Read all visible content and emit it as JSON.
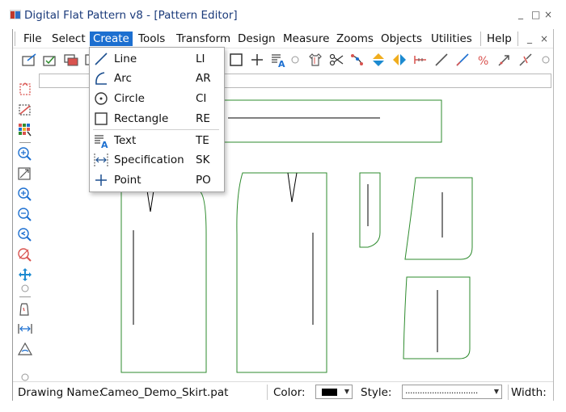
{
  "window": {
    "title": "Digital Flat Pattern v8 - [Pattern Editor]",
    "app_controls": [
      "_",
      "□",
      "×"
    ],
    "doc_controls": [
      "_",
      "□",
      "×"
    ]
  },
  "menubar": {
    "items": [
      "File",
      "Select",
      "Create",
      "Tools",
      "Transform",
      "Design",
      "Measure",
      "Zooms",
      "Objects",
      "Utilities",
      "Help"
    ],
    "active": "Create"
  },
  "create_menu": {
    "items": [
      {
        "label": "Line",
        "shortcut": "LI",
        "icon": "line-icon"
      },
      {
        "label": "Arc",
        "shortcut": "AR",
        "icon": "arc-icon"
      },
      {
        "label": "Circle",
        "shortcut": "CI",
        "icon": "circle-icon"
      },
      {
        "label": "Rectangle",
        "shortcut": "RE",
        "icon": "rectangle-icon"
      },
      {
        "label": "Text",
        "shortcut": "TE",
        "icon": "text-icon"
      },
      {
        "label": "Specification",
        "shortcut": "SK",
        "icon": "specification-icon"
      },
      {
        "label": "Point",
        "shortcut": "PO",
        "icon": "point-icon"
      }
    ]
  },
  "command_input": {
    "value": ""
  },
  "statusbar": {
    "drawing_name_label": "Drawing Name:",
    "drawing_name": "Cameo_Demo_Skirt.pat",
    "color_label": "Color:",
    "color_value": "#000000",
    "style_label": "Style:",
    "style_value": "..............................",
    "width_label": "Width:"
  },
  "colors": {
    "pattern_outline": "#2e8b2e",
    "menu_highlight": "#1c6fd0",
    "title_text": "#1a3a7a"
  }
}
